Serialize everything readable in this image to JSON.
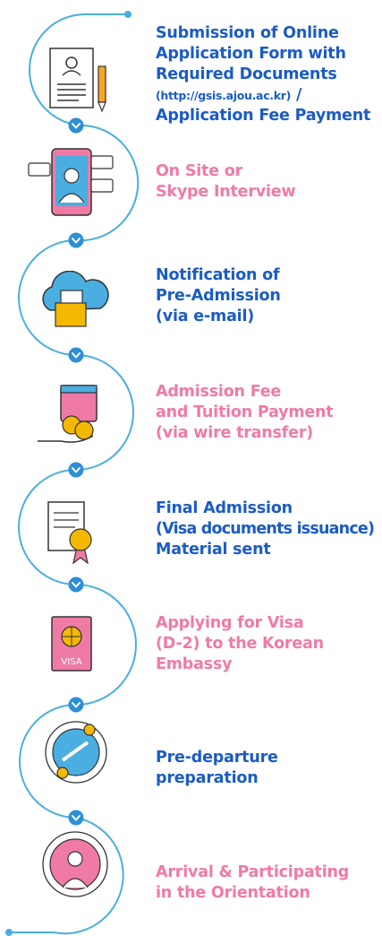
{
  "colors": {
    "blue_text": "#1b5cc4",
    "pink_text": "#f07aa6",
    "track": "#4aaee0",
    "chevron_badge": "#2d8fd6"
  },
  "steps": [
    {
      "icon": "application-form-icon",
      "color": "blue",
      "lines": [
        "Submission of Online",
        "Application Form with",
        "Required Documents"
      ],
      "url": "(http://gsis.ajou.ac.kr)",
      "slash": "/",
      "last_line": "Application Fee Payment"
    },
    {
      "icon": "video-interview-icon",
      "color": "pink",
      "lines": [
        "On Site or",
        "Skype Interview"
      ]
    },
    {
      "icon": "cloud-email-icon",
      "color": "blue",
      "lines": [
        "Notification of",
        "Pre-Admission",
        "(via e-mail)"
      ]
    },
    {
      "icon": "payment-wallet-icon",
      "color": "pink",
      "lines": [
        "Admission Fee",
        "and Tuition Payment",
        "(via wire transfer)"
      ]
    },
    {
      "icon": "certificate-icon",
      "color": "blue",
      "lines": [
        "Final Admission",
        "(Visa documents issuance)",
        "Material sent"
      ]
    },
    {
      "icon": "passport-icon",
      "color": "pink",
      "lines": [
        "Applying for Visa",
        "(D-2) to the Korean",
        "Embassy"
      ],
      "passport_label": "VISA"
    },
    {
      "icon": "globe-travel-icon",
      "color": "blue",
      "lines": [
        "Pre-departure",
        "preparation"
      ]
    },
    {
      "icon": "globe-person-icon",
      "color": "pink",
      "lines": [
        "Arrival & Participating",
        "in the Orientation"
      ]
    }
  ]
}
